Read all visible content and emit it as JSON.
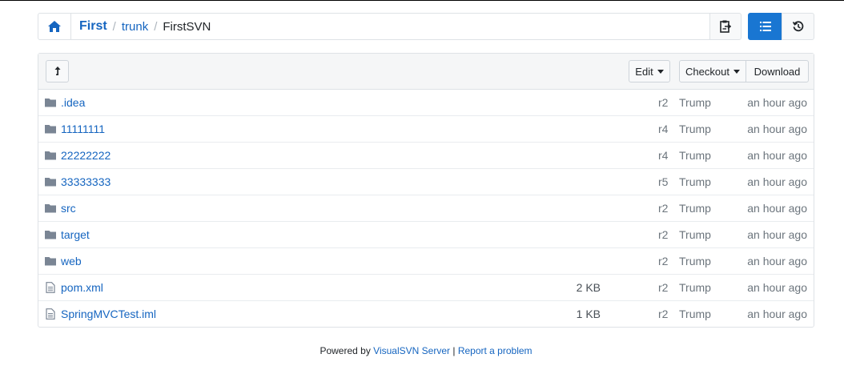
{
  "breadcrumb": {
    "repo": "First",
    "path": [
      "trunk"
    ],
    "current": "FirstSVN"
  },
  "toolbar": {
    "edit_label": "Edit",
    "checkout_label": "Checkout",
    "download_label": "Download"
  },
  "entries": [
    {
      "type": "folder",
      "name": ".idea",
      "size": "",
      "revision": "r2",
      "author": "Trump",
      "age": "an hour ago"
    },
    {
      "type": "folder",
      "name": "11111111",
      "size": "",
      "revision": "r4",
      "author": "Trump",
      "age": "an hour ago"
    },
    {
      "type": "folder",
      "name": "22222222",
      "size": "",
      "revision": "r4",
      "author": "Trump",
      "age": "an hour ago"
    },
    {
      "type": "folder",
      "name": "33333333",
      "size": "",
      "revision": "r5",
      "author": "Trump",
      "age": "an hour ago"
    },
    {
      "type": "folder",
      "name": "src",
      "size": "",
      "revision": "r2",
      "author": "Trump",
      "age": "an hour ago"
    },
    {
      "type": "folder",
      "name": "target",
      "size": "",
      "revision": "r2",
      "author": "Trump",
      "age": "an hour ago"
    },
    {
      "type": "folder",
      "name": "web",
      "size": "",
      "revision": "r2",
      "author": "Trump",
      "age": "an hour ago"
    },
    {
      "type": "file",
      "name": "pom.xml",
      "size": "2 KB",
      "revision": "r2",
      "author": "Trump",
      "age": "an hour ago"
    },
    {
      "type": "file",
      "name": "SpringMVCTest.iml",
      "size": "1 KB",
      "revision": "r2",
      "author": "Trump",
      "age": "an hour ago"
    }
  ],
  "footer": {
    "prefix": "Powered by",
    "product_link": "VisualSVN Server",
    "separator": "|",
    "report_link": "Report a problem"
  },
  "colors": {
    "link": "#1565c0",
    "primary": "#1976d2",
    "icon": "#7a8594"
  },
  "icons": {
    "home": "home-icon",
    "copy": "clipboard-copy-icon",
    "list": "list-view-icon",
    "history": "history-icon",
    "up": "level-up-icon",
    "folder": "folder-icon",
    "file": "file-icon"
  }
}
